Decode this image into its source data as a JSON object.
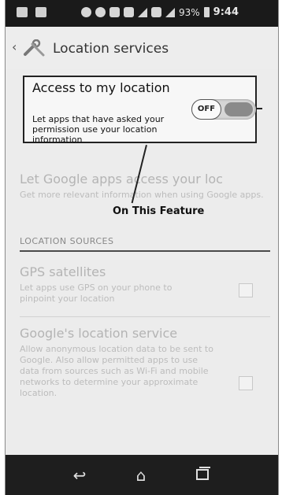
{
  "status_bar": {
    "battery": "93%",
    "time": "9:44"
  },
  "action_bar": {
    "back_glyph": "‹",
    "title": "Location services"
  },
  "access_toggle": {
    "title": "Access to my location",
    "description": "Let apps that have asked your permission use your location information",
    "state_label": "OFF"
  },
  "google_apps": {
    "title": "Let Google apps access your loc",
    "description": "Get more relevant information when using Google apps."
  },
  "annotation": {
    "label": "On This Feature"
  },
  "sources": {
    "header": "LOCATION SOURCES",
    "items": [
      {
        "title": "GPS satellites",
        "description": "Let apps use GPS on your phone to pinpoint your location"
      },
      {
        "title": "Google's location service",
        "description": "Allow anonymous location data to be sent to Google. Also allow permitted apps to use data from sources such as Wi-Fi and mobile networks to determine your approximate location."
      }
    ]
  },
  "nav": {
    "back_glyph": "↩",
    "home_glyph": "⌂"
  }
}
